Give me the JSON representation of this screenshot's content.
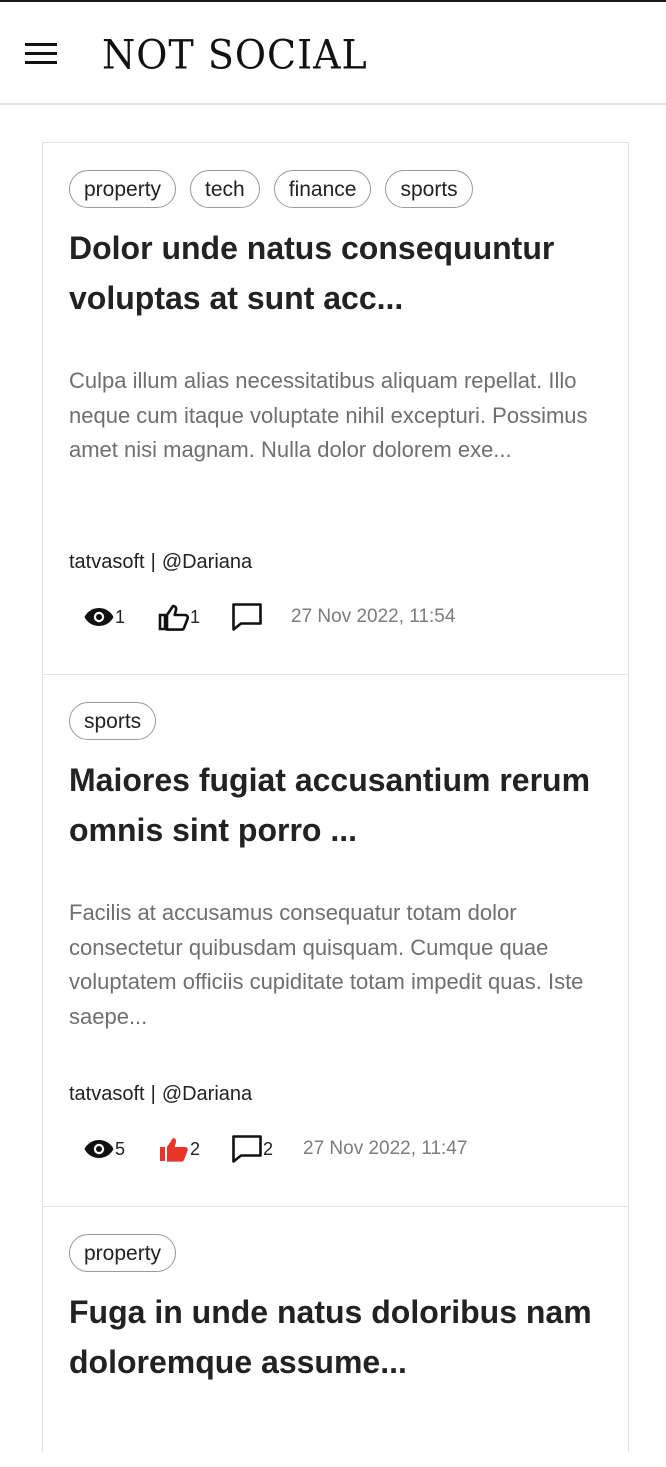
{
  "app": {
    "logo": "NOT SOCIAL"
  },
  "posts": [
    {
      "tags": [
        "property",
        "tech",
        "finance",
        "sports"
      ],
      "title": "Dolor unde natus consequuntur voluptas at sunt acc...",
      "excerpt": "Culpa illum alias necessitatibus aliquam repellat. Illo neque cum itaque voluptate nihil excepturi. Possimus amet nisi magnam. Nulla dolor dolorem exe...",
      "author": "tatvasoft",
      "separator": "|",
      "handle": "@Dariana",
      "views": "1",
      "likes": "1",
      "liked": false,
      "comments": "",
      "timestamp": "27 Nov 2022, 11:54"
    },
    {
      "tags": [
        "sports"
      ],
      "title": "Maiores fugiat accusantium rerum omnis sint porro ...",
      "excerpt": "Facilis at accusamus consequatur totam dolor consectetur quibusdam quisquam. Cumque quae voluptatem officiis cupiditate totam impedit quas. Iste saepe...",
      "author": "tatvasoft",
      "separator": "|",
      "handle": "@Dariana",
      "views": "5",
      "likes": "2",
      "liked": true,
      "comments": "2",
      "timestamp": "27 Nov 2022, 11:47"
    },
    {
      "tags": [
        "property"
      ],
      "title": "Fuga in unde natus doloribus nam doloremque assume..."
    }
  ],
  "colors": {
    "liked": "#e8352a",
    "text": "#222222",
    "muted": "#6f6f6f"
  },
  "icons": {
    "menu": "hamburger-menu-icon",
    "views": "eye-icon",
    "likes": "thumbs-up-icon",
    "comments": "comment-icon"
  }
}
